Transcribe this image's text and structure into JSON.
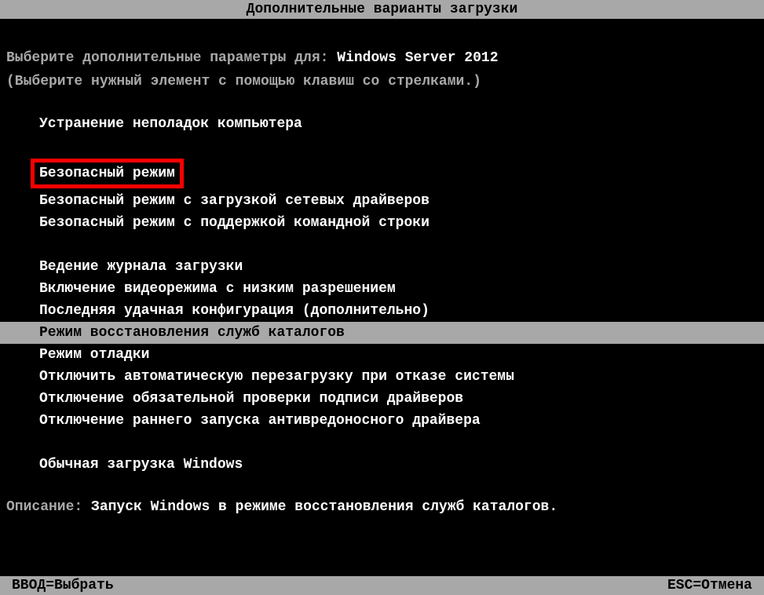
{
  "title": "Дополнительные варианты загрузки",
  "prompt": {
    "prefix": "Выберите дополнительные параметры для:",
    "os": "Windows Server 2012"
  },
  "instruction": "(Выберите нужный элемент с помощью клавиш со стрелками.)",
  "options": {
    "repair": "Устранение неполадок компьютера",
    "safe_mode": "Безопасный режим",
    "safe_mode_networking": "Безопасный режим с загрузкой сетевых драйверов",
    "safe_mode_cmd": "Безопасный режим с поддержкой командной строки",
    "boot_logging": "Ведение журнала загрузки",
    "low_res_video": "Включение видеорежима с низким разрешением",
    "last_known_good": "Последняя удачная конфигурация (дополнительно)",
    "dsrm": "Режим восстановления служб каталогов",
    "debug_mode": "Режим отладки",
    "disable_auto_restart": "Отключить автоматическую перезагрузку при отказе системы",
    "disable_driver_sig": "Отключение обязательной проверки подписи драйверов",
    "disable_early_av": "Отключение раннего запуска антивредоносного драйвера",
    "normal_boot": "Обычная загрузка Windows"
  },
  "description": {
    "label": "Описание:",
    "text": "Запуск Windows в режиме восстановления служб каталогов."
  },
  "footer": {
    "select": "ВВОД=Выбрать",
    "cancel": "ESC=Отмена"
  }
}
